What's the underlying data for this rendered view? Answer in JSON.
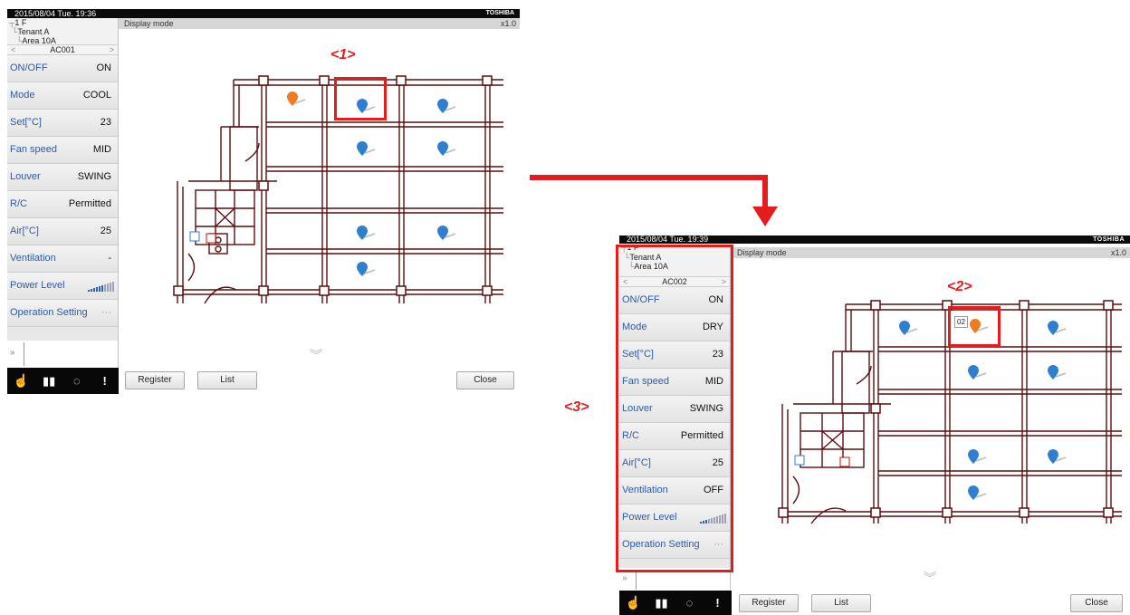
{
  "screen1": {
    "datetime": "2015/08/04  Tue.  19:36",
    "brand": "TOSHIBA",
    "title": "Display mode",
    "zoom": "x1.0",
    "tree": [
      "1 F",
      "Tenant A",
      "Area 10A"
    ],
    "unit": "AC001",
    "rows": [
      {
        "label": "ON/OFF",
        "value": "ON"
      },
      {
        "label": "Mode",
        "value": "COOL"
      },
      {
        "label": "Set[°C]",
        "value": "23"
      },
      {
        "label": "Fan speed",
        "value": "MID"
      },
      {
        "label": "Louver",
        "value": "SWING"
      },
      {
        "label": "R/C",
        "value": "Permitted"
      },
      {
        "label": "Air[°C]",
        "value": "25"
      },
      {
        "label": "Ventilation",
        "value": "-"
      },
      {
        "label": "Power Level",
        "value": ""
      },
      {
        "label": "Operation Setting",
        "value": "···"
      }
    ],
    "power_level": 0.6,
    "expand_icon": "»",
    "buttons": {
      "register": "Register",
      "list": "List",
      "close": "Close"
    }
  },
  "screen2": {
    "datetime": "2015/08/04  Tue.  19:39",
    "brand": "TOSHIBA",
    "title": "Display mode",
    "zoom": "x1.0",
    "tree": [
      "1 F",
      "Tenant A",
      "Area 10A"
    ],
    "unit": "AC002",
    "rows": [
      {
        "label": "ON/OFF",
        "value": "ON"
      },
      {
        "label": "Mode",
        "value": "DRY"
      },
      {
        "label": "Set[°C]",
        "value": "23"
      },
      {
        "label": "Fan speed",
        "value": "MID"
      },
      {
        "label": "Louver",
        "value": "SWING"
      },
      {
        "label": "R/C",
        "value": "Permitted"
      },
      {
        "label": "Air[°C]",
        "value": "25"
      },
      {
        "label": "Ventilation",
        "value": "OFF"
      },
      {
        "label": "Power Level",
        "value": ""
      },
      {
        "label": "Operation Setting",
        "value": "···"
      }
    ],
    "power_level": 0.3,
    "expand_icon": "»",
    "tooltip": "02",
    "buttons": {
      "register": "Register",
      "list": "List",
      "close": "Close"
    }
  },
  "callouts": {
    "c1": "<1>",
    "c2": "<2>",
    "c3": "<3>"
  },
  "colors": {
    "callout_red": "#e31d1d",
    "unit_blue": "#2f7fd0",
    "unit_orange": "#f07a20",
    "plan_line": "#5a0e0e"
  },
  "icons": [
    "hand-icon",
    "book-icon",
    "dashed-circle-icon",
    "alert-icon",
    "chevron-down-icon",
    "ac-unit-pin-icon"
  ]
}
